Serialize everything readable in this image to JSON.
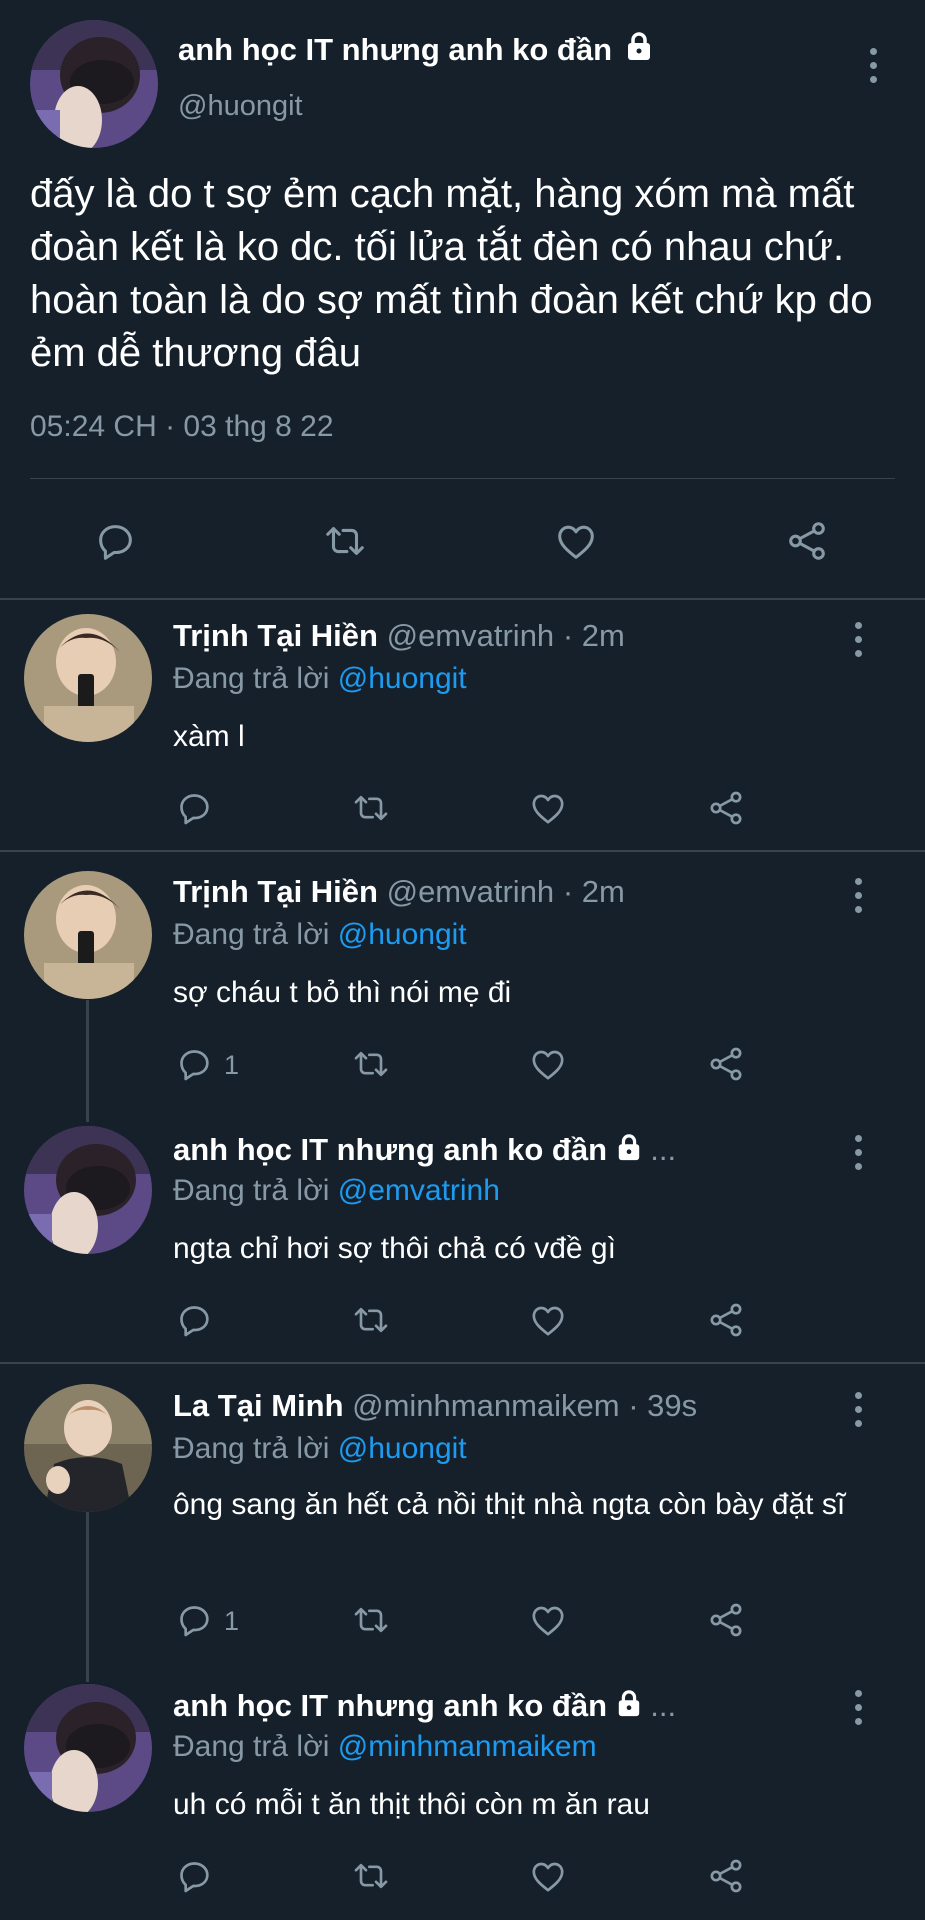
{
  "main_tweet": {
    "display_name": "anh học IT nhưng anh ko đần",
    "handle": "@huongit",
    "text": "đấy là do t sợ ẻm cạch mặt, hàng xóm mà mất đoàn kết là ko dc. tối lửa tắt đèn có nhau chứ. hoàn toàn là do sợ mất tình đoàn kết chứ kp do ẻm dễ thương đâu",
    "timestamp": "05:24 CH · 03 thg 8 22",
    "icons": [
      "reply-icon",
      "retweet-icon",
      "like-icon",
      "share-icon"
    ]
  },
  "replies": [
    {
      "name": "Trịnh Tại Hiền",
      "handle": "@emvatrinh",
      "time": "· 2m",
      "replying_label": "Đang trả lời",
      "replying_to": "@huongit",
      "text": "xàm l",
      "reply_count": ""
    },
    {
      "name": "Trịnh Tại Hiền",
      "handle": "@emvatrinh",
      "time": "· 2m",
      "replying_label": "Đang trả lời",
      "replying_to": "@huongit",
      "text": "sợ cháu t bỏ thì nói mẹ đi",
      "reply_count": "1"
    },
    {
      "name": "anh học IT nhưng anh ko đần",
      "handle": "...",
      "time": "",
      "replying_label": "Đang trả lời",
      "replying_to": "@emvatrinh",
      "text": "ngta chỉ hơi sợ thôi chả có vđề gì",
      "reply_count": ""
    },
    {
      "name": "La Tại Minh",
      "handle": "@minhmanmaikem",
      "time": "· 39s",
      "replying_label": "Đang trả lời",
      "replying_to": "@huongit",
      "text": "ông sang ăn hết cả nồi thịt nhà ngta còn bày đặt sĩ",
      "reply_count": "1"
    },
    {
      "name": "anh học IT nhưng anh ko đần",
      "handle": "...",
      "time": "",
      "replying_label": "Đang trả lời",
      "replying_to": "@minhmanmaikem",
      "text": "uh có mỗi t ăn thịt thôi còn m ăn rau",
      "reply_count": ""
    }
  ],
  "colors": {
    "background": "#15202b",
    "muted": "#8899a6",
    "link": "#1d9bf0",
    "divider": "#38444d"
  }
}
